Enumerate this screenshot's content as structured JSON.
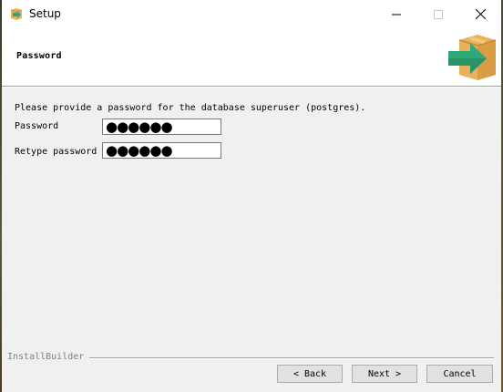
{
  "window": {
    "title": "Setup",
    "controls": {
      "minimize": "minimize-icon",
      "maximize": "maximize-icon",
      "close": "close-icon"
    }
  },
  "header": {
    "page_title": "Password",
    "icon": "installer-box-arrow-icon"
  },
  "main": {
    "description": "Please provide a password for the database superuser (postgres).",
    "password_label": "Password",
    "password_value": "●●●●●●",
    "retype_label": "Retype password",
    "retype_value": "●●●●●●"
  },
  "footer": {
    "brand": "InstallBuilder",
    "back_label": "< Back",
    "next_label": "Next >",
    "cancel_label": "Cancel"
  },
  "colors": {
    "accent_green": "#2ea878",
    "box_orange": "#e8b15a",
    "button_face": "#e1e1e1",
    "dialog_bg": "#f0f0f0"
  }
}
